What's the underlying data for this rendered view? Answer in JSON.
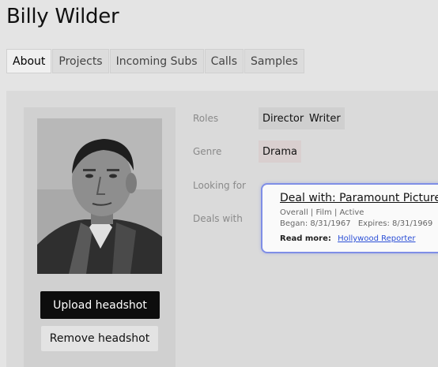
{
  "header": {
    "title": "Billy Wilder"
  },
  "tabs": [
    {
      "label": "About",
      "active": true
    },
    {
      "label": "Projects",
      "active": false
    },
    {
      "label": "Incoming Subs",
      "active": false
    },
    {
      "label": "Calls",
      "active": false
    },
    {
      "label": "Samples",
      "active": false
    }
  ],
  "headshot": {
    "upload_label": "Upload headshot",
    "remove_label": "Remove headshot"
  },
  "fields": {
    "roles_label": "Roles",
    "roles": [
      "Director",
      "Writer"
    ],
    "genre_label": "Genre",
    "genre": "Drama",
    "looking_for_label": "Looking for",
    "deals_with_label": "Deals with"
  },
  "deal": {
    "title": "Deal with: Paramount Pictures",
    "type_line": "Overall | Film | Active",
    "began": "Began: 8/31/1967",
    "expires": "Expires: 8/31/1969",
    "read_more_label": "Read more:",
    "read_more_link": "Hollywood Reporter"
  },
  "colors": {
    "background": "#e4e4e4",
    "primary_button": "#0d0d0d",
    "deal_border": "#7f8ee6",
    "link": "#2b4fd6"
  }
}
